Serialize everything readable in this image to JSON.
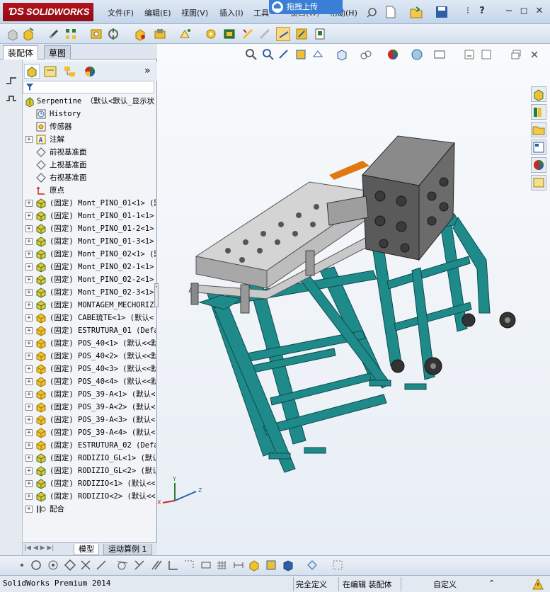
{
  "app": {
    "name": "SOLIDWORKS",
    "menus": [
      "文件(F)",
      "编辑(E)",
      "视图(V)",
      "插入(I)",
      "工具",
      "窗口(W)",
      "帮助(H)"
    ],
    "upload_label": "拖拽上传"
  },
  "left_panel": {
    "tabs": [
      "装配体",
      "草图"
    ],
    "bottom_tabs": [
      "模型",
      "运动算例 1"
    ],
    "tree": [
      {
        "label": "Serpentine （默认<默认_显示状",
        "icon": "assembly-icon",
        "expand": ""
      },
      {
        "label": "History",
        "icon": "history-icon",
        "expand": ""
      },
      {
        "label": "传感器",
        "icon": "sensor-icon",
        "expand": ""
      },
      {
        "label": "注解",
        "icon": "annotation-icon",
        "expand": "+"
      },
      {
        "label": "前视基准面",
        "icon": "plane-icon",
        "expand": ""
      },
      {
        "label": "上视基准面",
        "icon": "plane-icon",
        "expand": ""
      },
      {
        "label": "右视基准面",
        "icon": "plane-icon",
        "expand": ""
      },
      {
        "label": "原点",
        "icon": "origin-icon",
        "expand": ""
      },
      {
        "label": "(固定) Mont_PINO_01<1> (默",
        "icon": "subassembly-icon",
        "expand": "+"
      },
      {
        "label": "(固定) Mont_PINO_01-1<1>",
        "icon": "subassembly-icon",
        "expand": "+"
      },
      {
        "label": "(固定) Mont_PINO_01-2<1>",
        "icon": "subassembly-icon",
        "expand": "+"
      },
      {
        "label": "(固定) Mont_PINO_01-3<1>",
        "icon": "subassembly-icon",
        "expand": "+"
      },
      {
        "label": "(固定) Mont_PINO_02<1> (默",
        "icon": "subassembly-icon",
        "expand": "+"
      },
      {
        "label": "(固定) Mont_PINO_02-1<1>",
        "icon": "subassembly-icon",
        "expand": "+"
      },
      {
        "label": "(固定) Mont_PINO_02-2<1>",
        "icon": "subassembly-icon",
        "expand": "+"
      },
      {
        "label": "(固定) Mont_PINO_02-3<1>",
        "icon": "subassembly-icon",
        "expand": "+"
      },
      {
        "label": "(固定) MONTAGEM_MECHORIZ",
        "icon": "subassembly-icon",
        "expand": "+"
      },
      {
        "label": "(固定) CABE琉TE<1> (默认<",
        "icon": "part-icon",
        "expand": "+"
      },
      {
        "label": "(固定) ESTRUTURA_01 (Defau",
        "icon": "part-icon",
        "expand": "+"
      },
      {
        "label": "(固定) POS_40<1> (默认<<默",
        "icon": "part-icon",
        "expand": "+"
      },
      {
        "label": "(固定) POS_40<2> (默认<<默",
        "icon": "part-icon",
        "expand": "+"
      },
      {
        "label": "(固定) POS_40<3> (默认<<默",
        "icon": "part-icon",
        "expand": "+"
      },
      {
        "label": "(固定) POS_40<4> (默认<<默",
        "icon": "part-icon",
        "expand": "+"
      },
      {
        "label": "(固定) POS_39-A<1> (默认<",
        "icon": "part-icon",
        "expand": "+"
      },
      {
        "label": "(固定) POS_39-A<2> (默认<",
        "icon": "part-icon",
        "expand": "+"
      },
      {
        "label": "(固定) POS_39-A<3> (默认<",
        "icon": "part-icon",
        "expand": "+"
      },
      {
        "label": "(固定) POS_39-A<4> (默认<",
        "icon": "part-icon",
        "expand": "+"
      },
      {
        "label": "(固定) ESTRUTURA_02 (Defau",
        "icon": "part-icon",
        "expand": "+"
      },
      {
        "label": "(固定) RODIZIO_GL<1> (默认",
        "icon": "subassembly-icon",
        "expand": "+"
      },
      {
        "label": "(固定) RODIZIO_GL<2> (默认",
        "icon": "subassembly-icon",
        "expand": "+"
      },
      {
        "label": "(固定) RODIZIO<1> (默认<<",
        "icon": "subassembly-icon",
        "expand": "+"
      },
      {
        "label": "(固定) RODIZIO<2> (默认<<",
        "icon": "subassembly-icon",
        "expand": "+"
      },
      {
        "label": "配合",
        "icon": "mates-icon",
        "expand": "+"
      }
    ]
  },
  "status": {
    "product": "SolidWorks Premium 2014",
    "definition": "完全定义",
    "editing": "在编辑 装配体",
    "units": "自定义"
  },
  "colors": {
    "frame": "#1f8a8a",
    "box": "#5a5a5a",
    "tray": "#bfbfbf",
    "accent": "#e07a10"
  }
}
